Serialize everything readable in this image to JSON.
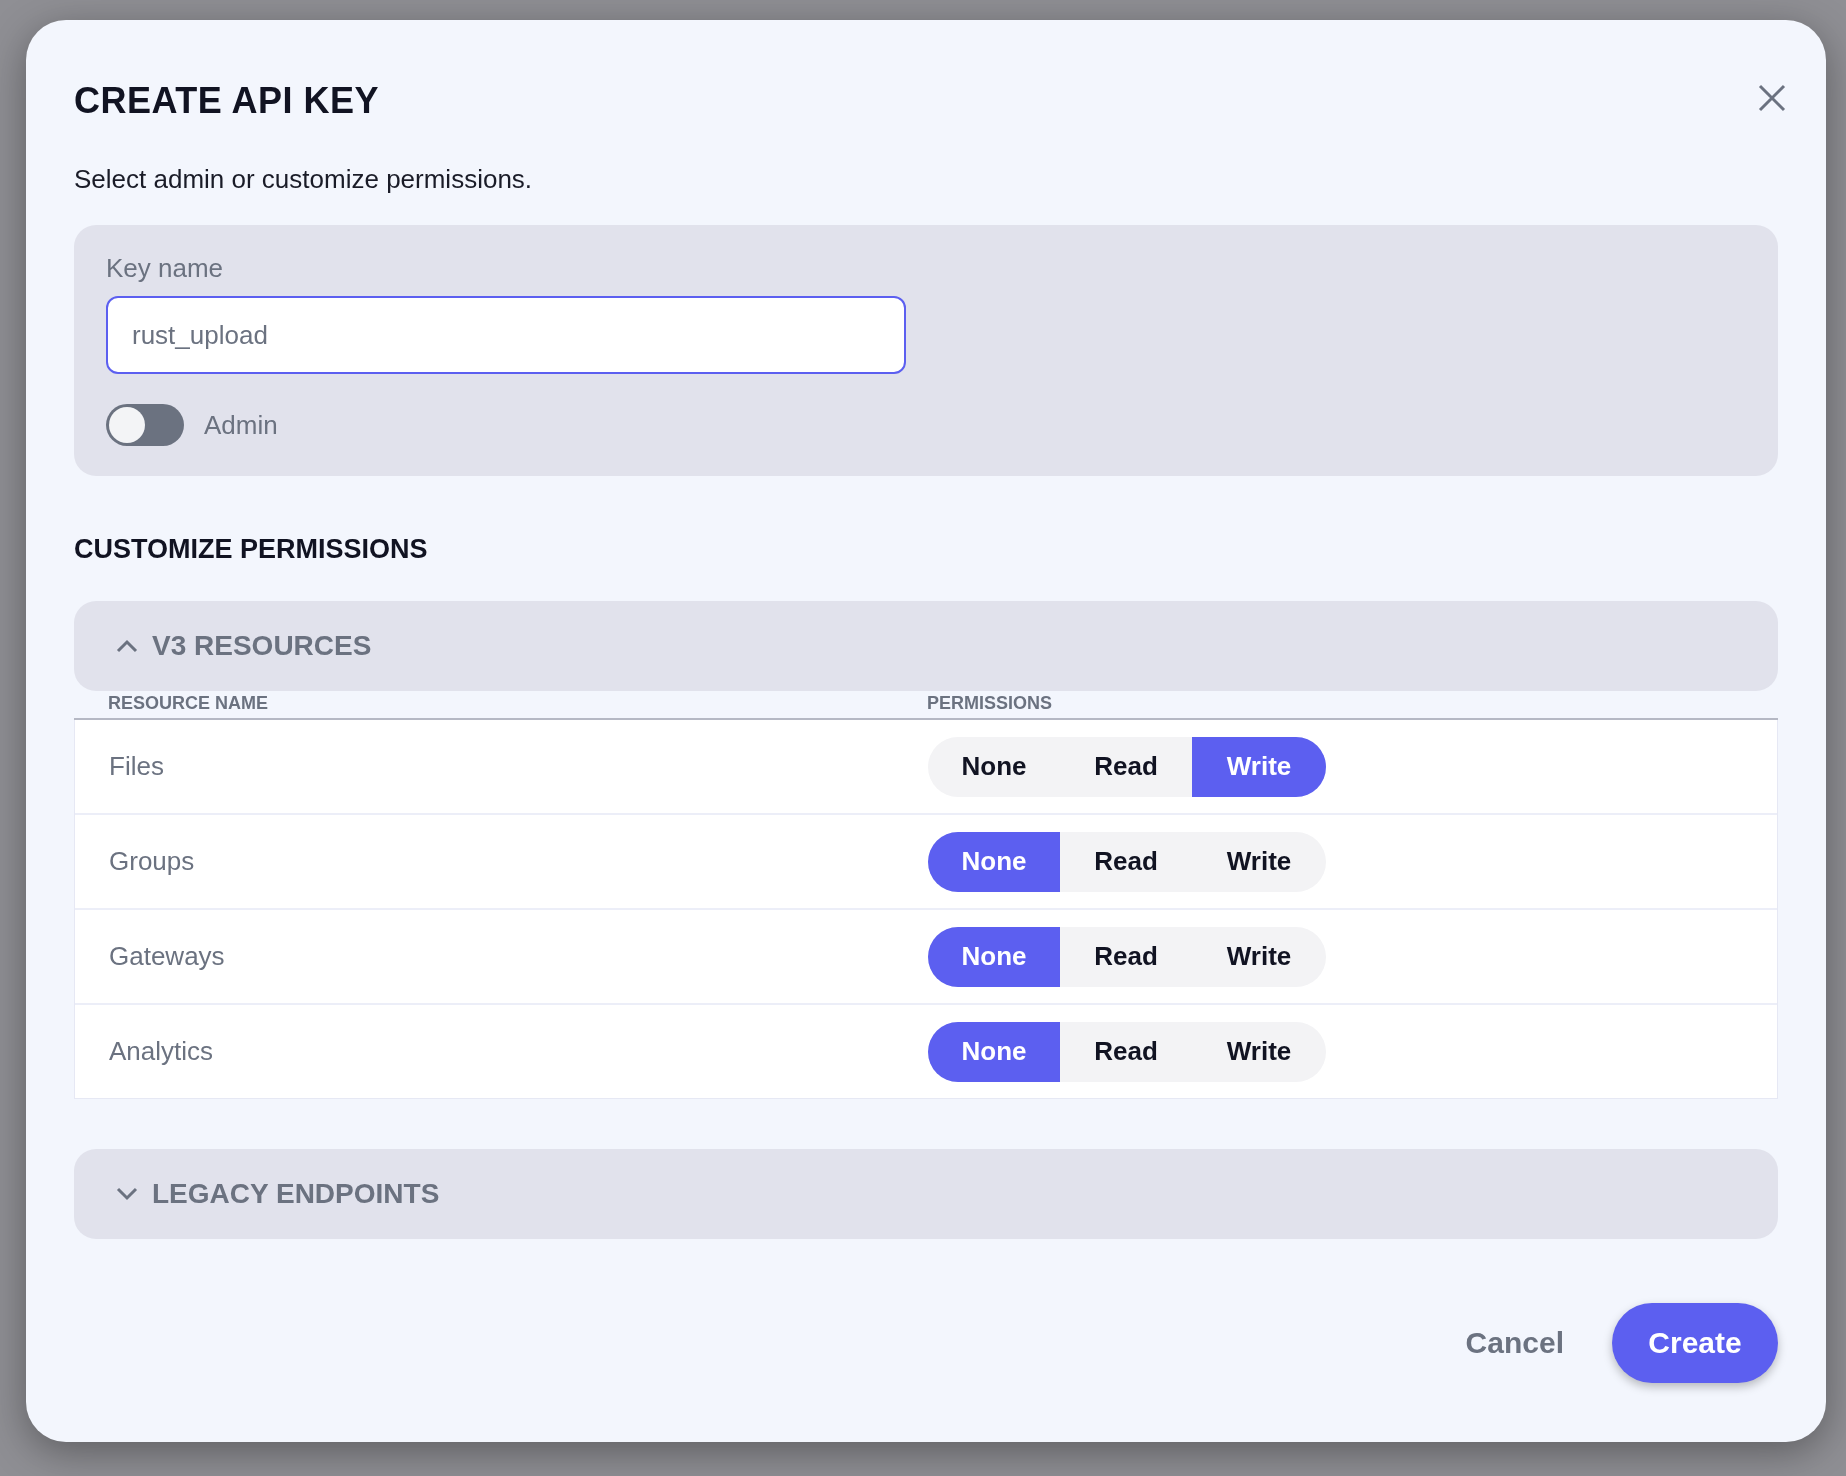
{
  "dialog": {
    "title": "CREATE API KEY",
    "subtitle": "Select admin or customize permissions."
  },
  "key_name": {
    "label": "Key name",
    "value": "rust_upload"
  },
  "admin_toggle": {
    "label": "Admin",
    "on": false
  },
  "section_title": "CUSTOMIZE PERMISSIONS",
  "groups": [
    {
      "title": "V3 RESOURCES",
      "expanded": true,
      "columns": [
        "RESOURCE NAME",
        "PERMISSIONS"
      ],
      "rows": [
        {
          "name": "Files",
          "options": [
            {
              "label": "None",
              "selected": false
            },
            {
              "label": "Read",
              "selected": false
            },
            {
              "label": "Write",
              "selected": true
            }
          ]
        },
        {
          "name": "Groups",
          "options": [
            {
              "label": "None",
              "selected": true
            },
            {
              "label": "Read",
              "selected": false
            },
            {
              "label": "Write",
              "selected": false
            }
          ]
        },
        {
          "name": "Gateways",
          "options": [
            {
              "label": "None",
              "selected": true
            },
            {
              "label": "Read",
              "selected": false
            },
            {
              "label": "Write",
              "selected": false
            }
          ]
        },
        {
          "name": "Analytics",
          "options": [
            {
              "label": "None",
              "selected": true
            },
            {
              "label": "Read",
              "selected": false
            },
            {
              "label": "Write",
              "selected": false
            }
          ]
        }
      ]
    },
    {
      "title": "LEGACY ENDPOINTS",
      "expanded": false
    }
  ],
  "buttons": {
    "cancel": "Cancel",
    "create": "Create"
  }
}
